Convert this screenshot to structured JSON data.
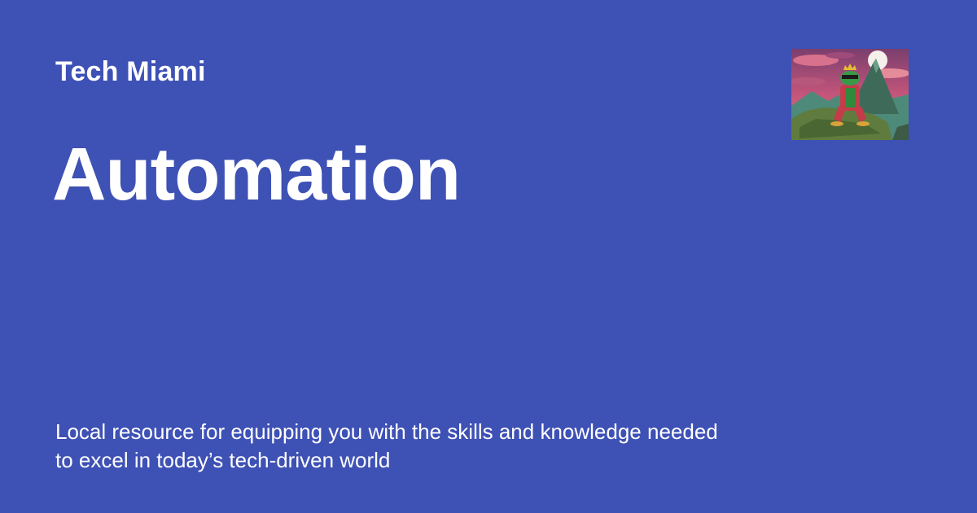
{
  "site": {
    "name": "Tech Miami"
  },
  "page": {
    "title": "Automation",
    "description": "Local resource for equipping you with the skills and knowledge needed to excel in today’s tech-driven world"
  },
  "thumbnail": {
    "icon": "frog-on-mountain-illustration"
  },
  "colors": {
    "background": "#3e51b5",
    "text": "#ffffff"
  }
}
